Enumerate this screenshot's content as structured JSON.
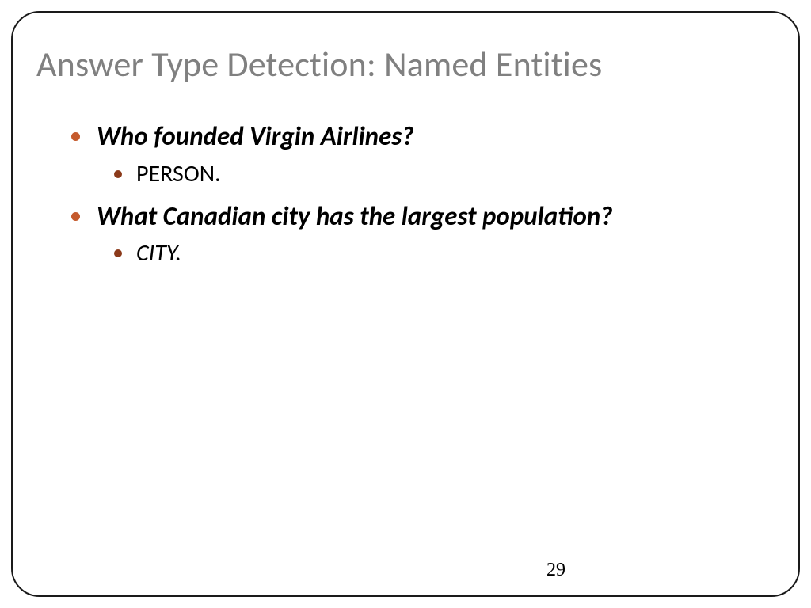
{
  "slide": {
    "title": "Answer Type Detection: Named Entities",
    "items": [
      {
        "text": "Who founded Virgin Airlines?",
        "sub": "PERSON.",
        "sub_italic": false
      },
      {
        "text": "What Canadian city has the largest population?",
        "sub": "CITY.",
        "sub_italic": true
      }
    ],
    "page_number": "29"
  }
}
